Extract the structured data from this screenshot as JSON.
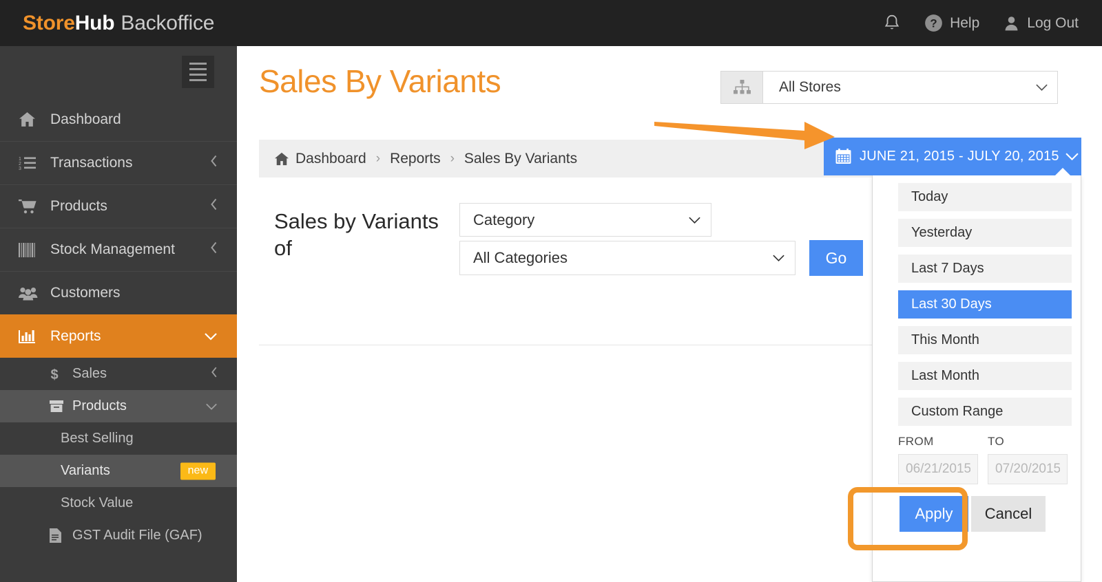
{
  "topbar": {
    "brand": {
      "part1": "Store",
      "part2": "Hub",
      "part3": "Backoffice"
    },
    "notifications_label": "",
    "help_label": "Help",
    "logout_label": "Log Out"
  },
  "sidebar": {
    "items": [
      {
        "label": "Dashboard",
        "icon": "home-icon",
        "chevron": "",
        "active": false
      },
      {
        "label": "Transactions",
        "icon": "ordered-list-icon",
        "chevron": "‹",
        "active": false
      },
      {
        "label": "Products",
        "icon": "cart-icon",
        "chevron": "‹",
        "active": false
      },
      {
        "label": "Stock Management",
        "icon": "barcode-icon",
        "chevron": "‹",
        "active": false
      },
      {
        "label": "Customers",
        "icon": "users-icon",
        "chevron": "",
        "active": false
      },
      {
        "label": "Reports",
        "icon": "bar-chart-icon",
        "chevron": "⌄",
        "active": true
      }
    ],
    "sub_items": [
      {
        "label": "Sales",
        "icon": "dollar-icon",
        "chevron": "‹",
        "badge": ""
      },
      {
        "label": "Products",
        "icon": "box-icon",
        "chevron": "⌄",
        "badge": ""
      },
      {
        "label": "Best Selling",
        "icon": "",
        "chevron": "",
        "badge": ""
      },
      {
        "label": "Variants",
        "icon": "",
        "chevron": "",
        "badge": "new"
      },
      {
        "label": "Stock Value",
        "icon": "",
        "chevron": "",
        "badge": ""
      },
      {
        "label": "GST Audit File (GAF)",
        "icon": "document-icon",
        "chevron": "",
        "badge": ""
      }
    ]
  },
  "main": {
    "page_title": "Sales By Variants",
    "store_selector": {
      "value": "All Stores",
      "icon": "sitemap-icon"
    },
    "breadcrumb": [
      "Dashboard",
      "Reports",
      "Sales By Variants"
    ],
    "breadcrumb_separator": "›",
    "form": {
      "label": "Sales by Variants of",
      "type_select_value": "Category",
      "category_select_value": "All Categories",
      "go_label": "Go"
    }
  },
  "date_picker": {
    "button_label": "JUNE 21, 2015 - JULY 20, 2015",
    "button_icon": "calendar-icon",
    "options": [
      {
        "label": "Today",
        "selected": false
      },
      {
        "label": "Yesterday",
        "selected": false
      },
      {
        "label": "Last 7 Days",
        "selected": false
      },
      {
        "label": "Last 30 Days",
        "selected": true
      },
      {
        "label": "This Month",
        "selected": false
      },
      {
        "label": "Last Month",
        "selected": false
      },
      {
        "label": "Custom Range",
        "selected": false
      }
    ],
    "from_label": "FROM",
    "to_label": "TO",
    "from_value": "06/21/2015",
    "to_value": "07/20/2015",
    "apply_label": "Apply",
    "cancel_label": "Cancel"
  },
  "colors": {
    "brand_orange": "#f0922b",
    "sidebar_active": "#e0811e",
    "accent_blue": "#4a8df3",
    "badge_yellow": "#fbb917",
    "annotation_orange": "#f2982c",
    "topbar_dark": "#222222",
    "sidebar_dark": "#3b3b3b"
  }
}
